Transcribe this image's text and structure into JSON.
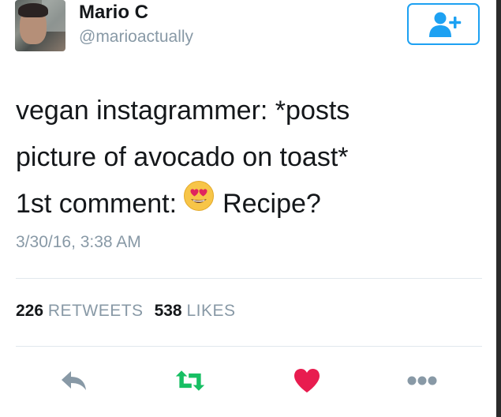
{
  "user": {
    "display_name": "Mario C",
    "handle": "@marioactually"
  },
  "follow_button": {
    "icon": "add-user-icon",
    "color": "#1da1f2"
  },
  "tweet": {
    "lines": [
      "vegan instagrammer: *posts",
      "picture of avocado on toast*",
      "1st comment:"
    ],
    "after_emoji": "Recipe?",
    "emoji": "heart-eyes-emoji",
    "timestamp": "3/30/16, 3:38 AM"
  },
  "stats": {
    "retweets_count": "226",
    "retweets_label": "RETWEETS",
    "likes_count": "538",
    "likes_label": "LIKES"
  },
  "actions": [
    {
      "name": "reply",
      "icon": "reply-icon",
      "color": "#8899a6"
    },
    {
      "name": "retweet",
      "icon": "retweet-icon",
      "color": "#17bf63"
    },
    {
      "name": "like",
      "icon": "heart-icon",
      "color": "#e81c4f"
    },
    {
      "name": "more",
      "icon": "more-icon",
      "color": "#8899a6"
    }
  ]
}
